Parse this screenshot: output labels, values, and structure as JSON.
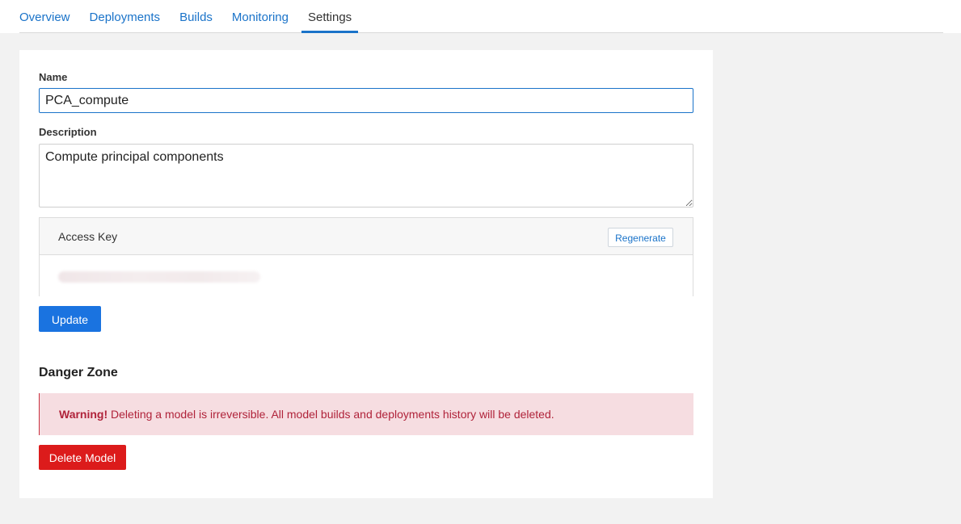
{
  "tabs": [
    {
      "label": "Overview",
      "active": false
    },
    {
      "label": "Deployments",
      "active": false
    },
    {
      "label": "Builds",
      "active": false
    },
    {
      "label": "Monitoring",
      "active": false
    },
    {
      "label": "Settings",
      "active": true
    }
  ],
  "form": {
    "name_label": "Name",
    "name_value": "PCA_compute",
    "description_label": "Description",
    "description_value": "Compute principal components"
  },
  "access_key": {
    "title": "Access Key",
    "regenerate_label": "Regenerate",
    "value_redacted": true
  },
  "update_label": "Update",
  "danger_zone": {
    "title": "Danger Zone",
    "warning_strong": "Warning!",
    "warning_text": " Deleting a model is irreversible. All model builds and deployments history will be deleted.",
    "delete_label": "Delete Model"
  },
  "colors": {
    "accent": "#1a73c9",
    "primary_button": "#1a73e0",
    "danger_button": "#dc1b1b",
    "warning_bg": "#f6dde1",
    "warning_text": "#b0233a",
    "page_bg": "#f2f2f2"
  }
}
